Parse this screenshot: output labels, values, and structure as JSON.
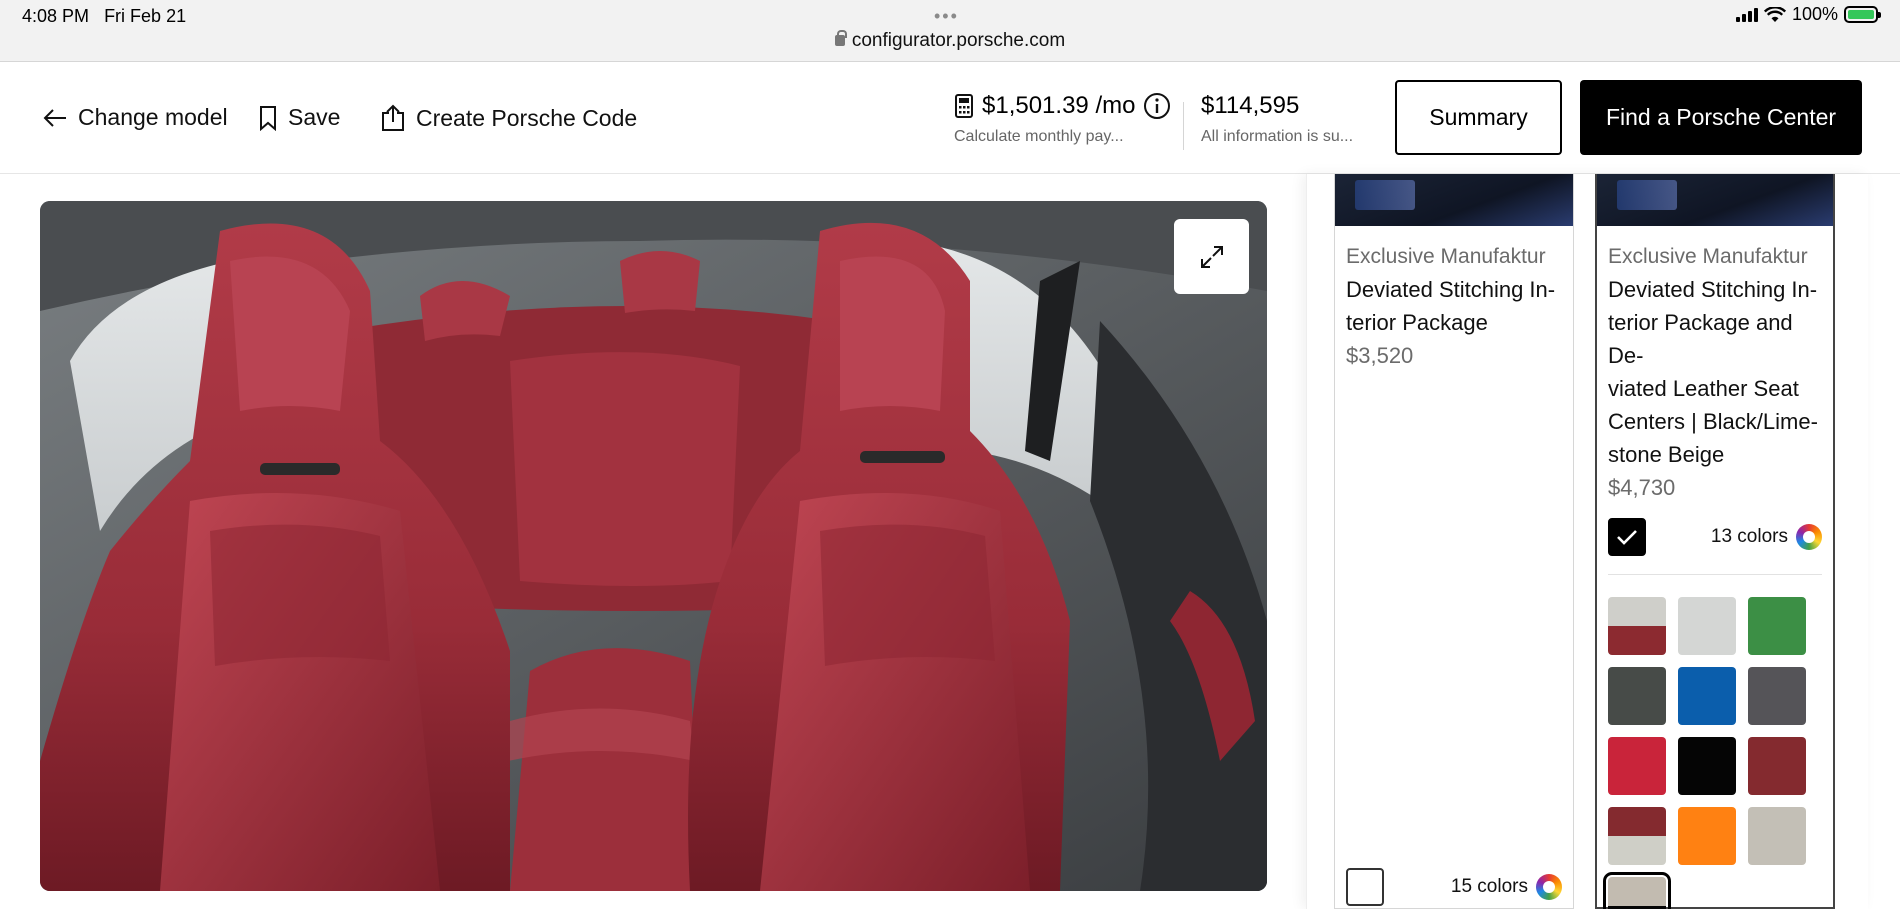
{
  "status_bar": {
    "time": "4:08 PM",
    "date": "Fri Feb 21",
    "url": "configurator.porsche.com",
    "battery": "100%"
  },
  "toolbar": {
    "change_model": "Change model",
    "save": "Save",
    "create_code": "Create Porsche Code",
    "monthly_price": "$1,501.39 /mo",
    "monthly_sub": "Calculate monthly pay...",
    "total_price": "$114,595",
    "total_sub": "All information is su...",
    "summary_label": "Summary",
    "find_center_label": "Find a Porsche Center"
  },
  "options": [
    {
      "category": "Exclusive Manufaktur",
      "name_lines": [
        "Deviated Stitching In-",
        "terior Package"
      ],
      "price": "$3,520",
      "selected": false,
      "colors_label": "15 colors"
    },
    {
      "category": "Exclusive Manufaktur",
      "name_lines": [
        "Deviated Stitching In-",
        "terior Package and De-",
        "viated Leather Seat",
        "Centers | Black/Lime-",
        "stone Beige"
      ],
      "price": "$4,730",
      "selected": true,
      "colors_label": "13 colors"
    }
  ],
  "swatches": [
    {
      "top": "#cfcfca",
      "bottom": "#8c2a30"
    },
    {
      "top": "#d4d6d4",
      "bottom": "#d4d6d4"
    },
    {
      "top": "#3c8f45",
      "bottom": "#3c8f45"
    },
    {
      "top": "#474b48",
      "bottom": "#474b48"
    },
    {
      "top": "#0b5eac",
      "bottom": "#0b5eac"
    },
    {
      "top": "#555458",
      "bottom": "#555458"
    },
    {
      "top": "#c9243a",
      "bottom": "#c9243a"
    },
    {
      "top": "#050505",
      "bottom": "#050505"
    },
    {
      "top": "#842a2f",
      "bottom": "#842a2f"
    },
    {
      "top": "#842a2f",
      "bottom": "#cfcfc7"
    },
    {
      "top": "#ff8112",
      "bottom": "#ff8112"
    },
    {
      "top": "#c3bfb6",
      "bottom": "#c3bfb6"
    },
    {
      "top": "#c2bbb0",
      "bottom": "#050505",
      "selected": true
    }
  ]
}
